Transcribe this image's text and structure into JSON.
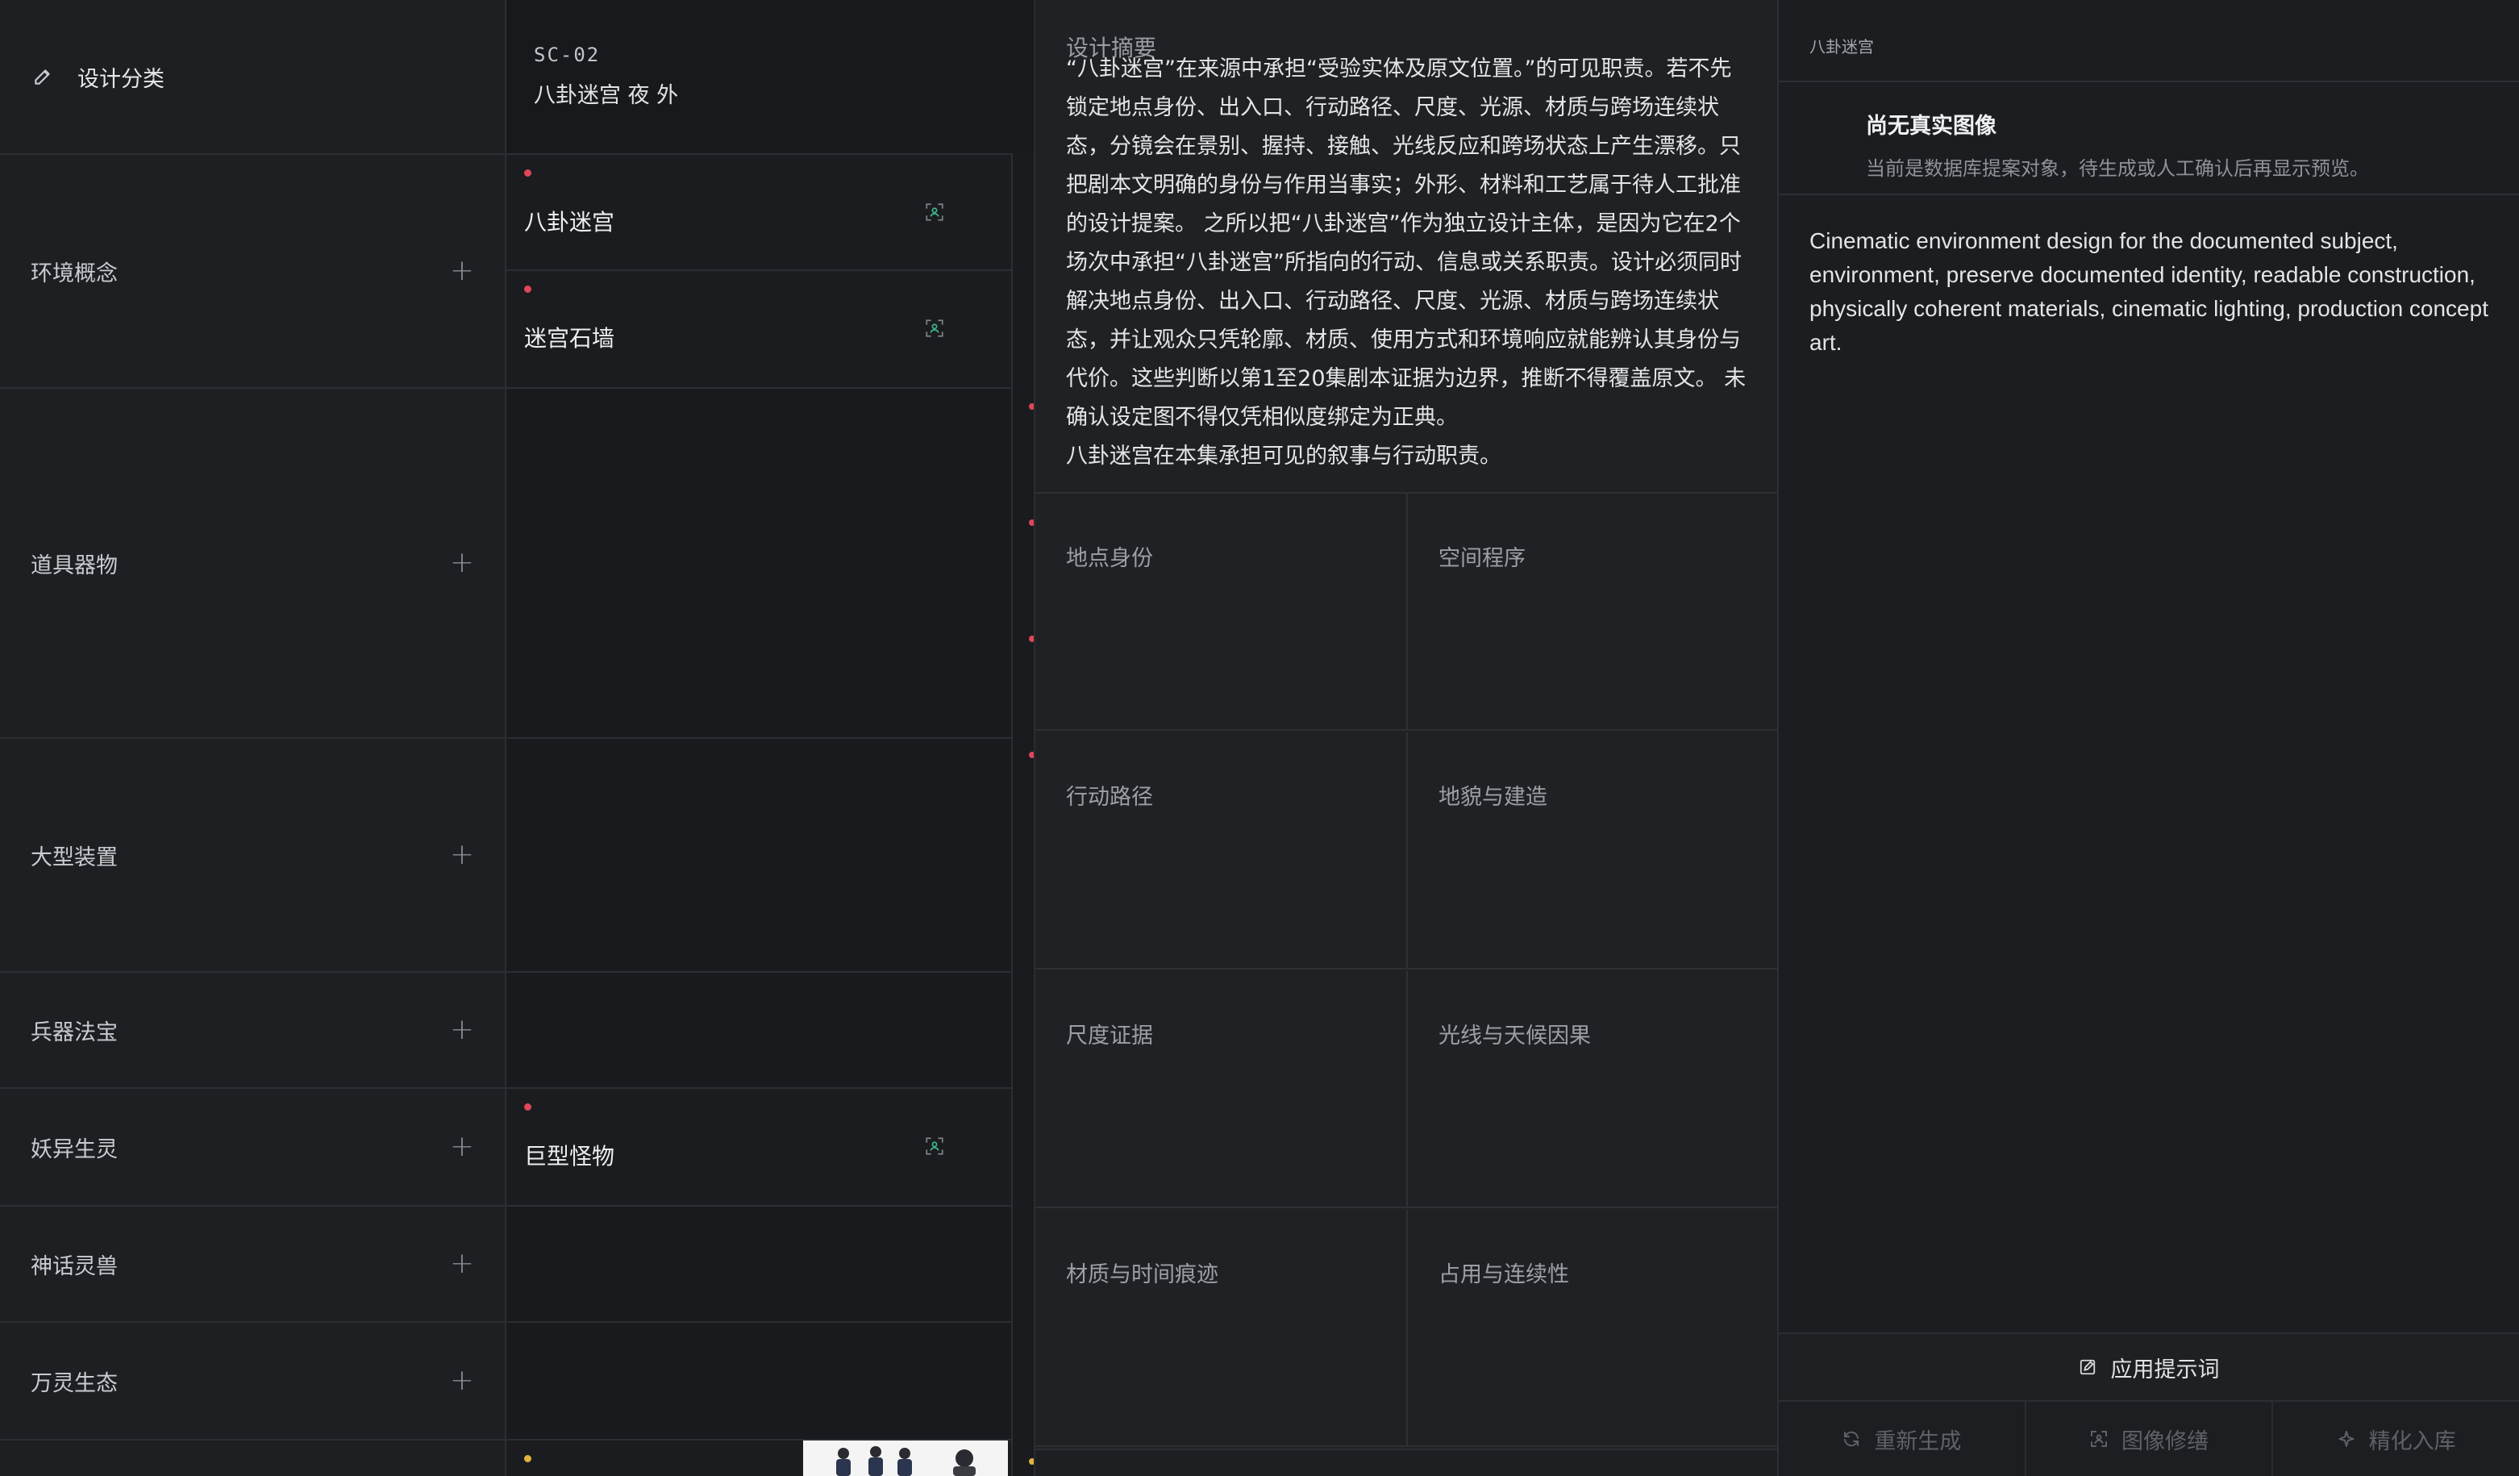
{
  "categories_panel": {
    "header_label": "设计分类",
    "items": [
      {
        "label": "环境概念"
      },
      {
        "label": "道具器物"
      },
      {
        "label": "大型装置"
      },
      {
        "label": "兵器法宝"
      },
      {
        "label": "妖异生灵"
      },
      {
        "label": "神话灵兽"
      },
      {
        "label": "万灵生态"
      }
    ]
  },
  "scene_panel": {
    "scene_id": "SC-02",
    "scene_title": "八卦迷宫 夜 外",
    "assets": [
      {
        "label": "八卦迷宫"
      },
      {
        "label": "迷宫石墙"
      },
      {
        "label": "巨型怪物"
      }
    ]
  },
  "summary_panel": {
    "title": "设计摘要",
    "paragraph_1": "“八卦迷宫”在来源中承担“受验实体及原文位置。”的可见职责。若不先锁定地点身份、出入口、行动路径、尺度、光源、材质与跨场连续状态，分镜会在景别、握持、接触、光线反应和跨场状态上产生漂移。只把剧本文明确的身份与作用当事实；外形、材料和工艺属于待人工批准的设计提案。 之所以把“八卦迷宫”作为独立设计主体，是因为它在2个场次中承担“八卦迷宫”所指向的行动、信息或关系职责。设计必须同时解决地点身份、出入口、行动路径、尺度、光源、材质与跨场连续状态，并让观众只凭轮廓、材质、使用方式和环境响应就能辨认其身份与代价。这些判断以第1至20集剧本证据为边界，推断不得覆盖原文。 未确认设定图不得仅凭相似度绑定为正典。",
    "paragraph_2": "八卦迷宫在本集承担可见的叙事与行动职责。",
    "grid": [
      {
        "label": "地点身份"
      },
      {
        "label": "空间程序"
      },
      {
        "label": "行动路径"
      },
      {
        "label": "地貌与建造"
      },
      {
        "label": "尺度证据"
      },
      {
        "label": "光线与天候因果"
      },
      {
        "label": "材质与时间痕迹"
      },
      {
        "label": "占用与连续性"
      }
    ]
  },
  "image_panel": {
    "asset_name": "八卦迷宫",
    "status_title": "尚无真实图像",
    "status_desc": "当前是数据库提案对象，待生成或人工确认后再显示预览。",
    "prompt": "Cinematic environment design for the documented subject, environment, preserve documented identity, readable construction, physically coherent materials, cinematic lighting, production concept art.",
    "apply_label": "应用提示词",
    "actions": [
      {
        "label": "重新生成",
        "icon": "refresh-icon"
      },
      {
        "label": "图像修缮",
        "icon": "image-edit-icon"
      },
      {
        "label": "精化入库",
        "icon": "sparkle-icon"
      }
    ]
  },
  "colors": {
    "background": "#18191c",
    "status_dot_red": "#e0455a",
    "status_dot_yellow": "#e0b341",
    "ai_icon_green": "#3fb58a"
  }
}
